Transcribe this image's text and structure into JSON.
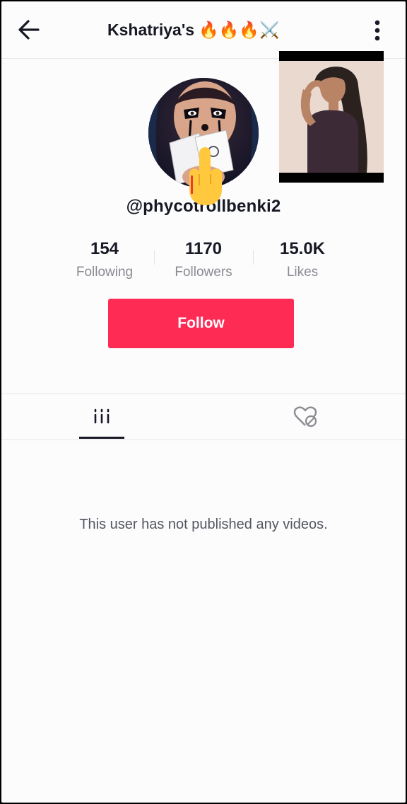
{
  "header": {
    "title": "Kshatriya's",
    "title_emojis": "🔥🔥🔥⚔️",
    "back_icon": "arrow-left-icon",
    "more_icon": "vertical-dots-icon"
  },
  "profile": {
    "username": "@phycotrollbenki2",
    "stats": [
      {
        "value": "154",
        "label": "Following"
      },
      {
        "value": "1170",
        "label": "Followers"
      },
      {
        "value": "15.0K",
        "label": "Likes"
      }
    ],
    "follow_label": "Follow"
  },
  "tabs": [
    {
      "icon": "grid-icon",
      "active": true
    },
    {
      "icon": "liked-hidden-icon",
      "active": false
    }
  ],
  "content": {
    "empty_message": "This user has not published any videos."
  },
  "colors": {
    "accent": "#fe2c55",
    "text": "#161823",
    "muted": "#8a8b91"
  }
}
